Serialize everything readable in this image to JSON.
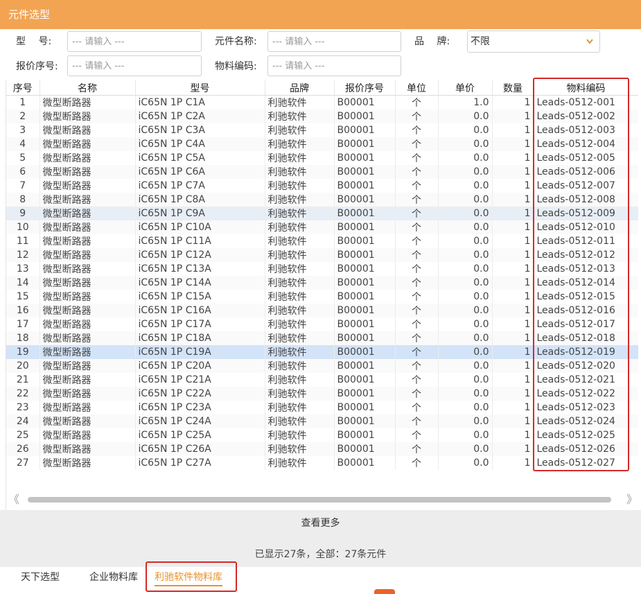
{
  "window": {
    "title": "元件选型"
  },
  "form": {
    "model_label": "型　 号:",
    "model_placeholder": "--- 请输入 ---",
    "name_label": "元件名称:",
    "name_placeholder": "--- 请输入 ---",
    "brand_label": "品　 牌:",
    "brand_value": "不限",
    "quote_label": "报价序号:",
    "quote_placeholder": "--- 请输入 ---",
    "material_label": "物料编码:",
    "material_placeholder": "--- 请输入 ---"
  },
  "table": {
    "headers": [
      "序号",
      "名称",
      "型号",
      "品牌",
      "报价序号",
      "单位",
      "单价",
      "数量",
      "物料编码"
    ],
    "rows": [
      [
        "1",
        "微型断路器",
        "iC65N 1P C1A",
        "利驰软件",
        "B00001",
        "个",
        "1.0",
        "1",
        "Leads-0512-001"
      ],
      [
        "2",
        "微型断路器",
        "iC65N 1P C2A",
        "利驰软件",
        "B00001",
        "个",
        "0.0",
        "1",
        "Leads-0512-002"
      ],
      [
        "3",
        "微型断路器",
        "iC65N 1P C3A",
        "利驰软件",
        "B00001",
        "个",
        "0.0",
        "1",
        "Leads-0512-003"
      ],
      [
        "4",
        "微型断路器",
        "iC65N 1P C4A",
        "利驰软件",
        "B00001",
        "个",
        "0.0",
        "1",
        "Leads-0512-004"
      ],
      [
        "5",
        "微型断路器",
        "iC65N 1P C5A",
        "利驰软件",
        "B00001",
        "个",
        "0.0",
        "1",
        "Leads-0512-005"
      ],
      [
        "6",
        "微型断路器",
        "iC65N 1P C6A",
        "利驰软件",
        "B00001",
        "个",
        "0.0",
        "1",
        "Leads-0512-006"
      ],
      [
        "7",
        "微型断路器",
        "iC65N 1P C7A",
        "利驰软件",
        "B00001",
        "个",
        "0.0",
        "1",
        "Leads-0512-007"
      ],
      [
        "8",
        "微型断路器",
        "iC65N 1P C8A",
        "利驰软件",
        "B00001",
        "个",
        "0.0",
        "1",
        "Leads-0512-008"
      ],
      [
        "9",
        "微型断路器",
        "iC65N 1P C9A",
        "利驰软件",
        "B00001",
        "个",
        "0.0",
        "1",
        "Leads-0512-009"
      ],
      [
        "10",
        "微型断路器",
        "iC65N 1P C10A",
        "利驰软件",
        "B00001",
        "个",
        "0.0",
        "1",
        "Leads-0512-010"
      ],
      [
        "11",
        "微型断路器",
        "iC65N 1P C11A",
        "利驰软件",
        "B00001",
        "个",
        "0.0",
        "1",
        "Leads-0512-011"
      ],
      [
        "12",
        "微型断路器",
        "iC65N 1P C12A",
        "利驰软件",
        "B00001",
        "个",
        "0.0",
        "1",
        "Leads-0512-012"
      ],
      [
        "13",
        "微型断路器",
        "iC65N 1P C13A",
        "利驰软件",
        "B00001",
        "个",
        "0.0",
        "1",
        "Leads-0512-013"
      ],
      [
        "14",
        "微型断路器",
        "iC65N 1P C14A",
        "利驰软件",
        "B00001",
        "个",
        "0.0",
        "1",
        "Leads-0512-014"
      ],
      [
        "15",
        "微型断路器",
        "iC65N 1P C15A",
        "利驰软件",
        "B00001",
        "个",
        "0.0",
        "1",
        "Leads-0512-015"
      ],
      [
        "16",
        "微型断路器",
        "iC65N 1P C16A",
        "利驰软件",
        "B00001",
        "个",
        "0.0",
        "1",
        "Leads-0512-016"
      ],
      [
        "17",
        "微型断路器",
        "iC65N 1P C17A",
        "利驰软件",
        "B00001",
        "个",
        "0.0",
        "1",
        "Leads-0512-017"
      ],
      [
        "18",
        "微型断路器",
        "iC65N 1P C18A",
        "利驰软件",
        "B00001",
        "个",
        "0.0",
        "1",
        "Leads-0512-018"
      ],
      [
        "19",
        "微型断路器",
        "iC65N 1P C19A",
        "利驰软件",
        "B00001",
        "个",
        "0.0",
        "1",
        "Leads-0512-019"
      ],
      [
        "20",
        "微型断路器",
        "iC65N 1P C20A",
        "利驰软件",
        "B00001",
        "个",
        "0.0",
        "1",
        "Leads-0512-020"
      ],
      [
        "21",
        "微型断路器",
        "iC65N 1P C21A",
        "利驰软件",
        "B00001",
        "个",
        "0.0",
        "1",
        "Leads-0512-021"
      ],
      [
        "22",
        "微型断路器",
        "iC65N 1P C22A",
        "利驰软件",
        "B00001",
        "个",
        "0.0",
        "1",
        "Leads-0512-022"
      ],
      [
        "23",
        "微型断路器",
        "iC65N 1P C23A",
        "利驰软件",
        "B00001",
        "个",
        "0.0",
        "1",
        "Leads-0512-023"
      ],
      [
        "24",
        "微型断路器",
        "iC65N 1P C24A",
        "利驰软件",
        "B00001",
        "个",
        "0.0",
        "1",
        "Leads-0512-024"
      ],
      [
        "25",
        "微型断路器",
        "iC65N 1P C25A",
        "利驰软件",
        "B00001",
        "个",
        "0.0",
        "1",
        "Leads-0512-025"
      ],
      [
        "26",
        "微型断路器",
        "iC65N 1P C26A",
        "利驰软件",
        "B00001",
        "个",
        "0.0",
        "1",
        "Leads-0512-026"
      ],
      [
        "27",
        "微型断路器",
        "iC65N 1P C27A",
        "利驰软件",
        "B00001",
        "个",
        "0.0",
        "1",
        "Leads-0512-027"
      ]
    ]
  },
  "footer": {
    "more_label": "查看更多",
    "count_text": "已显示27条，全部：27条元件"
  },
  "tabs": [
    {
      "label": "天下选型"
    },
    {
      "label": "企业物料库"
    },
    {
      "label": "利驰软件物料库"
    }
  ],
  "colors": {
    "titlebar": "#f2a453",
    "active_tab": "#e8932b",
    "annotation_box": "#d62828",
    "selected_row": "#d3e3f8"
  }
}
